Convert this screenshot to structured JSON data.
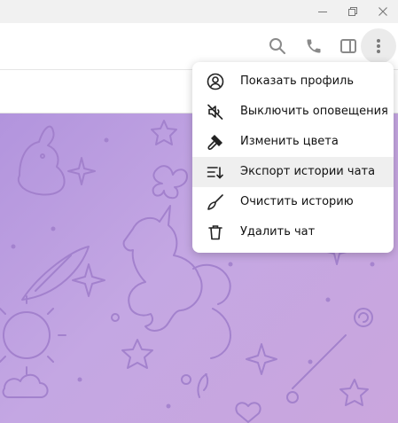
{
  "header": {
    "icons": [
      "search-icon",
      "phone-icon",
      "sidebar-toggle-icon",
      "more-vertical-icon"
    ]
  },
  "window_controls": [
    "minimize-icon",
    "restore-icon",
    "close-icon"
  ],
  "menu": {
    "items": [
      {
        "label": "Показать профиль",
        "icon": "profile-icon"
      },
      {
        "label": "Выключить оповещения",
        "icon": "mute-icon"
      },
      {
        "label": "Изменить цвета",
        "icon": "paint-icon"
      },
      {
        "label": "Экспорт истории чата",
        "icon": "export-icon"
      },
      {
        "label": "Очистить историю",
        "icon": "broom-icon"
      },
      {
        "label": "Удалить чат",
        "icon": "trash-icon"
      }
    ],
    "highlighted_index": 3
  },
  "colors": {
    "wallpaper_start": "#b294dd",
    "wallpaper_end": "#caa6dd",
    "menu_highlight": "#efefef"
  }
}
